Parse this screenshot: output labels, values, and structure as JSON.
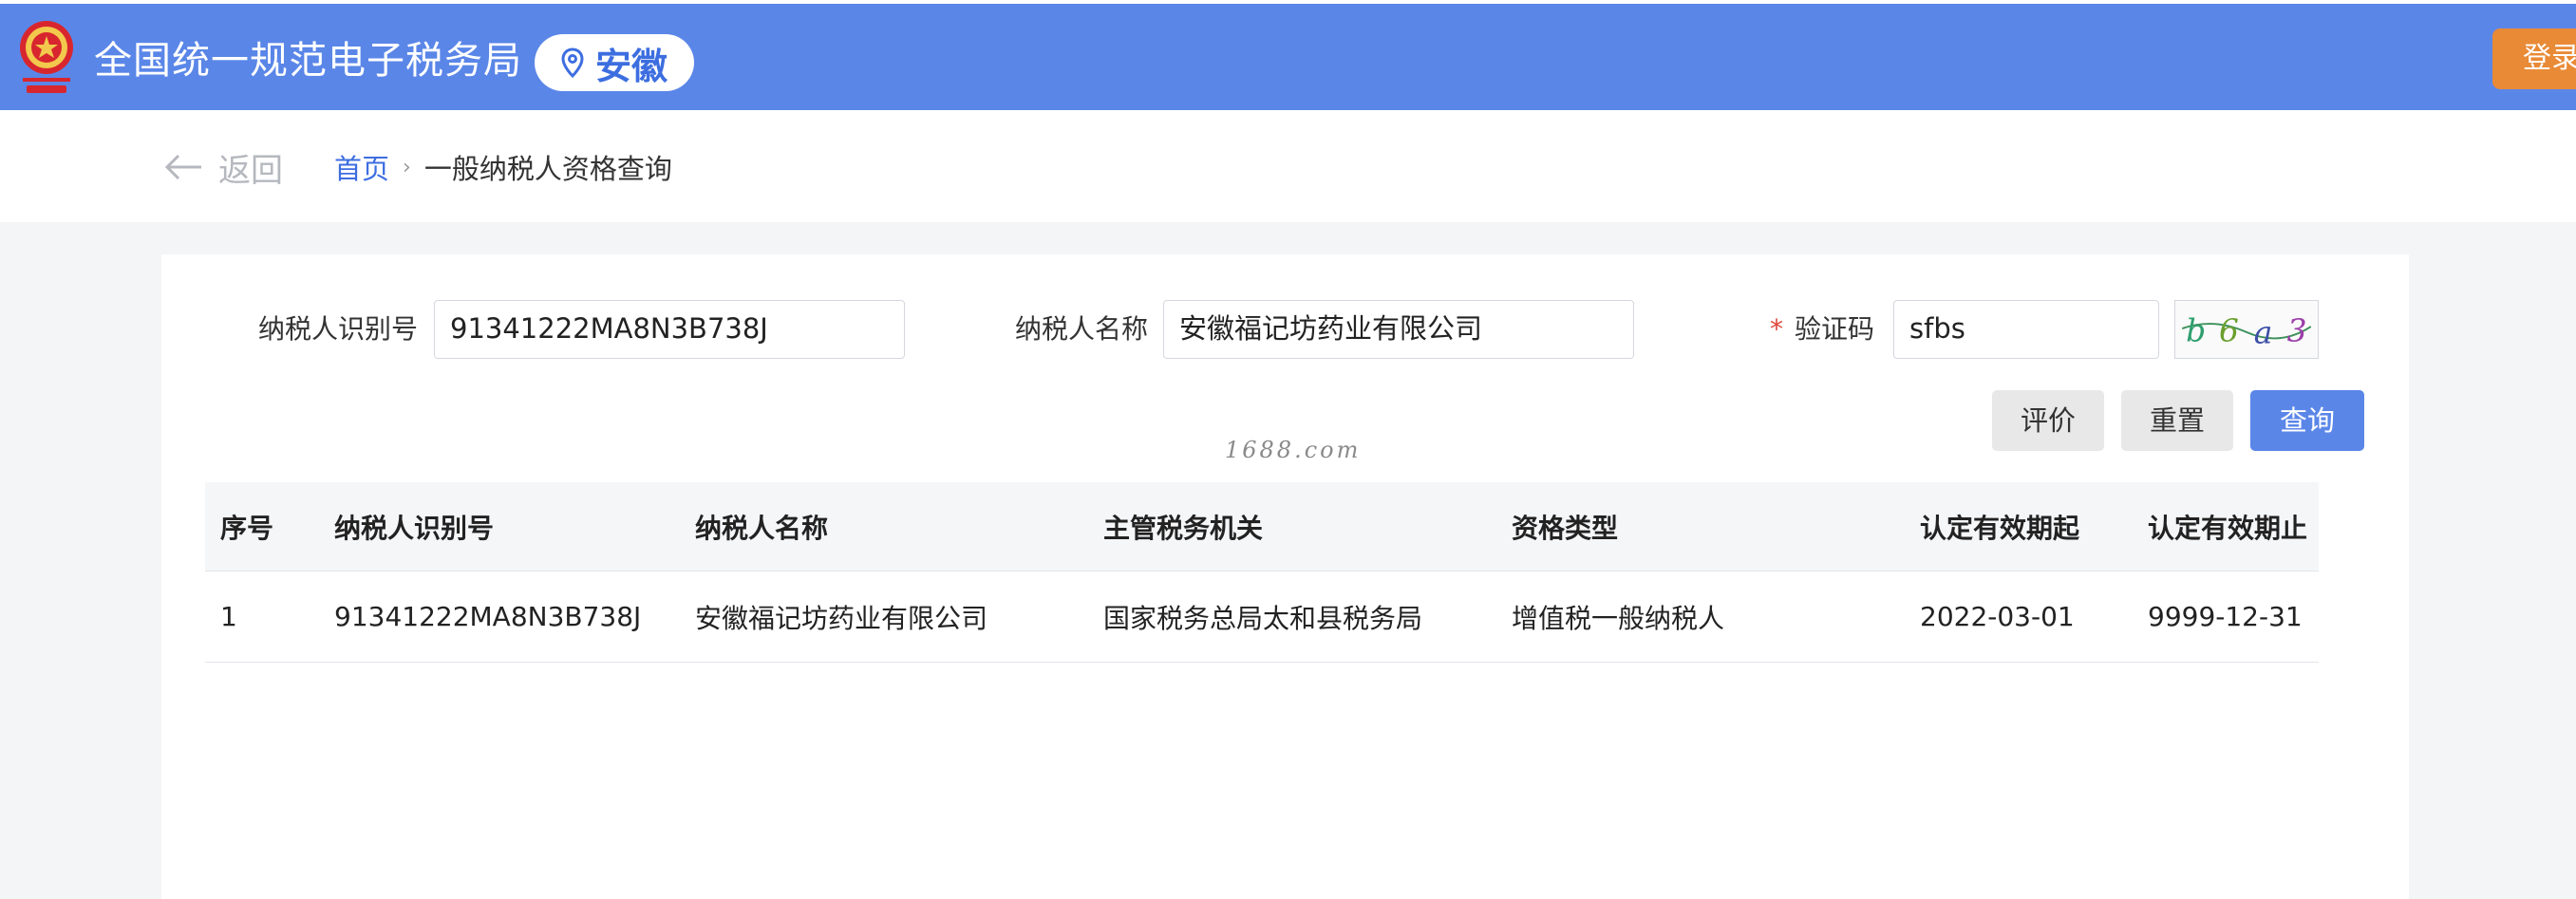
{
  "header": {
    "title": "全国统一规范电子税务局",
    "region": "安徽",
    "login_label": "登录"
  },
  "breadcrumb": {
    "back_label": "返回",
    "home": "首页",
    "separator": "›",
    "current": "一般纳税人资格查询"
  },
  "form": {
    "taxpayer_id_label": "纳税人识别号",
    "taxpayer_id_value": "91341222MA8N3B738J",
    "taxpayer_name_label": "纳税人名称",
    "taxpayer_name_value": "安徽福记坊药业有限公司",
    "captcha_required_mark": "*",
    "captcha_label": "验证码",
    "captcha_value": "sfbs",
    "captcha_image_text": "b6a3"
  },
  "buttons": {
    "evaluate": "评价",
    "reset": "重置",
    "query": "查询"
  },
  "watermark": "1688.com",
  "table": {
    "columns": [
      "序号",
      "纳税人识别号",
      "纳税人名称",
      "主管税务机关",
      "资格类型",
      "认定有效期起",
      "认定有效期止"
    ],
    "rows": [
      [
        "1",
        "91341222MA8N3B738J",
        "安徽福记坊药业有限公司",
        "国家税务总局太和县税务局",
        "增值税一般纳税人",
        "2022-03-01",
        "9999-12-31"
      ]
    ]
  },
  "colors": {
    "header_blue": "#5a86e8",
    "accent_blue": "#3d6ee0",
    "login_orange": "#e98a36",
    "required_red": "#e0443b"
  }
}
